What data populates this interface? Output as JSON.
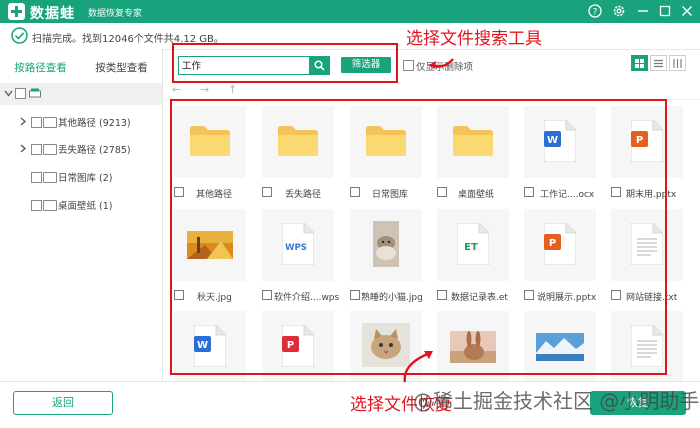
{
  "app": {
    "brand": "数据蛙",
    "slogan": "数据恢复专家",
    "accent": "#19a37c"
  },
  "status": {
    "text": "扫描完成。找到12046个文件共4.12 GB。"
  },
  "sidebar": {
    "tabs": [
      {
        "label": "按路径查看",
        "active": true
      },
      {
        "label": "按类型查看",
        "active": false
      }
    ],
    "items": [
      {
        "label": "其他路径 (9213)",
        "expandable": true
      },
      {
        "label": "丢失路径 (2785)",
        "expandable": true
      },
      {
        "label": "日常图库 (2)",
        "expandable": false
      },
      {
        "label": "桌面壁纸 (1)",
        "expandable": false
      }
    ]
  },
  "search": {
    "value": "工作"
  },
  "filter_label": "筛选器",
  "hide_deleted_label": "仅显示删除项",
  "annotations": {
    "top": "选择文件搜索工具",
    "bottom": "选择文件恢复"
  },
  "files": [
    {
      "name": "其他路径",
      "icon": "folder-icon"
    },
    {
      "name": "丢失路径",
      "icon": "folder-icon"
    },
    {
      "name": "日常图库",
      "icon": "folder-icon"
    },
    {
      "name": "桌面壁纸",
      "icon": "folder-icon"
    },
    {
      "name": "工作记....ocx",
      "icon": "word-doc-icon"
    },
    {
      "name": "期末用.pptx",
      "icon": "ppt-icon"
    },
    {
      "name": "秋天.jpg",
      "icon": "autumn-photo-thumbnail"
    },
    {
      "name": "软件介绍....wps",
      "icon": "wps-doc-icon"
    },
    {
      "name": "熟睡的小猫.jpg",
      "icon": "cat-photo-thumbnail"
    },
    {
      "name": "数据记录表.et",
      "icon": "et-sheet-icon"
    },
    {
      "name": "说明展示.pptx",
      "icon": "ppt-icon"
    },
    {
      "name": "网站链接.txt",
      "icon": "txt-doc-icon"
    },
    {
      "name": "",
      "icon": "word-doc-icon"
    },
    {
      "name": "",
      "icon": "pdf-doc-icon"
    },
    {
      "name": "",
      "icon": "kitten-photo-thumbnail"
    },
    {
      "name": "",
      "icon": "rabbit-photo-thumbnail"
    },
    {
      "name": "",
      "icon": "landscape-photo-thumbnail"
    },
    {
      "name": "",
      "icon": "txt-doc-icon"
    }
  ],
  "footer": {
    "back_label": "返回",
    "recover_label": "恢复"
  },
  "watermark": "@稀土掘金技术社区 @小明助手"
}
